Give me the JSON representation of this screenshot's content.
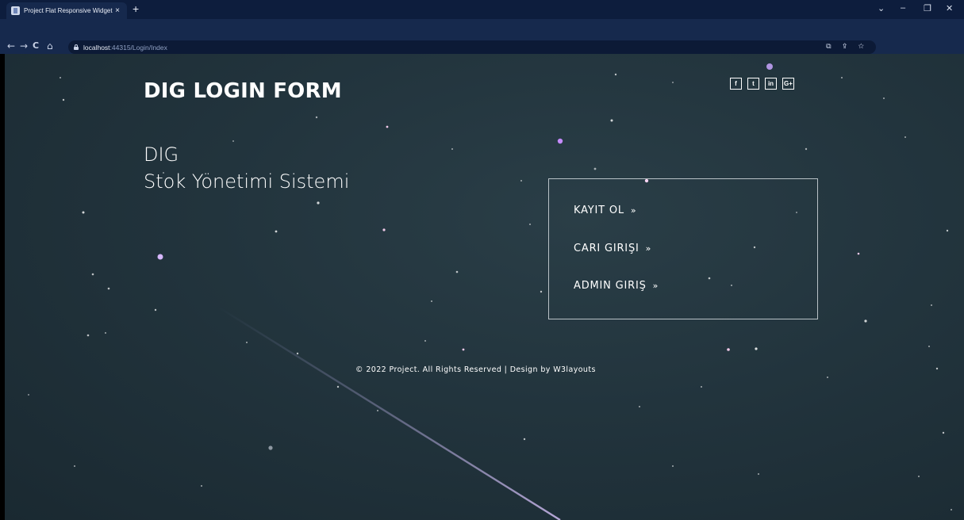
{
  "browser": {
    "tab_title": "Project Flat Responsive Widget T",
    "tab_close": "×",
    "new_tab": "+",
    "url_host": "localhost",
    "url_rest": ":44315/Login/Index",
    "nav": {
      "back": "←",
      "forward": "→",
      "reload": "C",
      "home": "⌂"
    },
    "window": {
      "dropdown": "⌄",
      "minimize": "–",
      "restore": "❐",
      "close": "✕"
    },
    "omnibox_icons": "⧉ ⇪ ☆"
  },
  "page": {
    "brand": "DIG LOGIN FORM",
    "subtitle_line1": "DIG",
    "subtitle_line2": "Stok Yönetimi Sistemi",
    "social": [
      {
        "icon": "facebook-icon",
        "glyph": "f"
      },
      {
        "icon": "twitter-icon",
        "glyph": "t"
      },
      {
        "icon": "linkedin-icon",
        "glyph": "in"
      },
      {
        "icon": "google-plus-icon",
        "glyph": "G+"
      }
    ],
    "menu": {
      "register": "KAYIT OL",
      "customer_login": "CARI GIRIŞI",
      "admin_login": "ADMIN GIRIŞ",
      "arrow": "»"
    },
    "footer": "© 2022 Project. All Rights Reserved | Design by W3layouts"
  },
  "colors": {
    "chrome_bg": "#16294d",
    "page_bg": "#22343d",
    "text": "#ffffff",
    "box_border": "#b9c2c7"
  }
}
